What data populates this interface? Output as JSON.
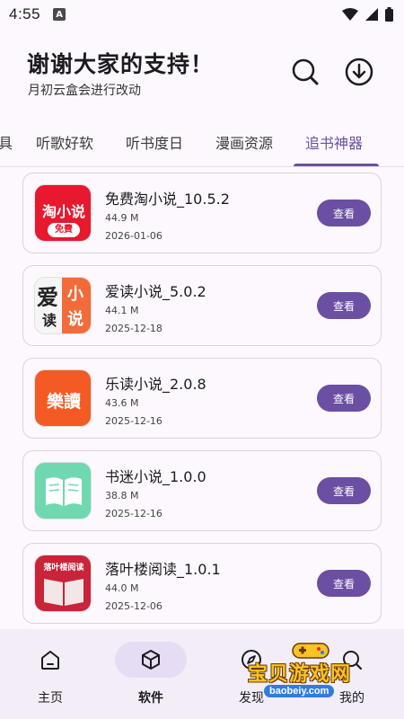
{
  "status_bar": {
    "time": "4:55",
    "notification_badge": "A"
  },
  "header": {
    "title": "谢谢大家的支持！",
    "subtitle": "月初云盒会进行改动"
  },
  "tabs": [
    {
      "label": "具"
    },
    {
      "label": "听歌好软"
    },
    {
      "label": "听书度日"
    },
    {
      "label": "漫画资源"
    },
    {
      "label": "追书神器",
      "active": true
    }
  ],
  "apps": [
    {
      "name": "免费淘小说_10.5.2",
      "size": "44.9 M",
      "date": "2026-01-06",
      "button": "查看",
      "icon_text": "淘小说",
      "icon_sub": "免費"
    },
    {
      "name": "爱读小说_5.0.2",
      "size": "44.1 M",
      "date": "2025-12-18",
      "button": "查看",
      "icon_text": "爱",
      "icon_text2": "读",
      "icon_text3": "小",
      "icon_text4": "说"
    },
    {
      "name": "乐读小说_2.0.8",
      "size": "43.6 M",
      "date": "2025-12-16",
      "button": "查看",
      "icon_text": "樂讀"
    },
    {
      "name": "书迷小说_1.0.0",
      "size": "38.8 M",
      "date": "2025-12-16",
      "button": "查看"
    },
    {
      "name": "落叶楼阅读_1.0.1",
      "size": "44.0 M",
      "date": "2025-12-06",
      "button": "查看",
      "icon_text": "落叶楼阅读"
    }
  ],
  "nav": [
    {
      "label": "主页",
      "icon": "home-icon"
    },
    {
      "label": "软件",
      "icon": "cube-icon",
      "active": true
    },
    {
      "label": "发现",
      "icon": "compass-icon"
    },
    {
      "label": "我的",
      "icon": "search-icon"
    }
  ],
  "watermark": {
    "title": "宝贝游戏网",
    "url": "baobeiy.com"
  },
  "colors": {
    "accent": "#6a4fa3",
    "background": "#fdf8fd",
    "nav_bg": "#f3edf7"
  }
}
